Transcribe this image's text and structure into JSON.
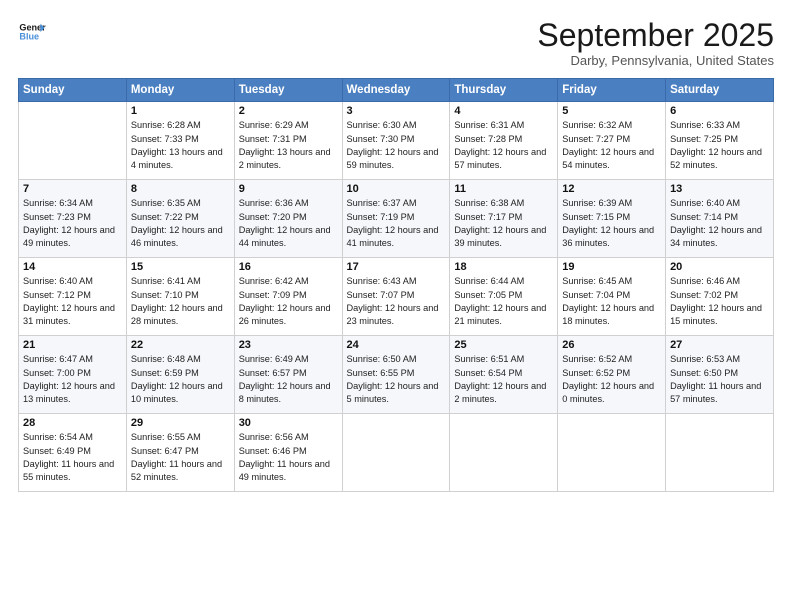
{
  "logo": {
    "line1": "General",
    "line2": "Blue"
  },
  "title": "September 2025",
  "location": "Darby, Pennsylvania, United States",
  "columns": [
    "Sunday",
    "Monday",
    "Tuesday",
    "Wednesday",
    "Thursday",
    "Friday",
    "Saturday"
  ],
  "weeks": [
    [
      {
        "day": "",
        "sunrise": "",
        "sunset": "",
        "daylight": ""
      },
      {
        "day": "1",
        "sunrise": "Sunrise: 6:28 AM",
        "sunset": "Sunset: 7:33 PM",
        "daylight": "Daylight: 13 hours and 4 minutes."
      },
      {
        "day": "2",
        "sunrise": "Sunrise: 6:29 AM",
        "sunset": "Sunset: 7:31 PM",
        "daylight": "Daylight: 13 hours and 2 minutes."
      },
      {
        "day": "3",
        "sunrise": "Sunrise: 6:30 AM",
        "sunset": "Sunset: 7:30 PM",
        "daylight": "Daylight: 12 hours and 59 minutes."
      },
      {
        "day": "4",
        "sunrise": "Sunrise: 6:31 AM",
        "sunset": "Sunset: 7:28 PM",
        "daylight": "Daylight: 12 hours and 57 minutes."
      },
      {
        "day": "5",
        "sunrise": "Sunrise: 6:32 AM",
        "sunset": "Sunset: 7:27 PM",
        "daylight": "Daylight: 12 hours and 54 minutes."
      },
      {
        "day": "6",
        "sunrise": "Sunrise: 6:33 AM",
        "sunset": "Sunset: 7:25 PM",
        "daylight": "Daylight: 12 hours and 52 minutes."
      }
    ],
    [
      {
        "day": "7",
        "sunrise": "Sunrise: 6:34 AM",
        "sunset": "Sunset: 7:23 PM",
        "daylight": "Daylight: 12 hours and 49 minutes."
      },
      {
        "day": "8",
        "sunrise": "Sunrise: 6:35 AM",
        "sunset": "Sunset: 7:22 PM",
        "daylight": "Daylight: 12 hours and 46 minutes."
      },
      {
        "day": "9",
        "sunrise": "Sunrise: 6:36 AM",
        "sunset": "Sunset: 7:20 PM",
        "daylight": "Daylight: 12 hours and 44 minutes."
      },
      {
        "day": "10",
        "sunrise": "Sunrise: 6:37 AM",
        "sunset": "Sunset: 7:19 PM",
        "daylight": "Daylight: 12 hours and 41 minutes."
      },
      {
        "day": "11",
        "sunrise": "Sunrise: 6:38 AM",
        "sunset": "Sunset: 7:17 PM",
        "daylight": "Daylight: 12 hours and 39 minutes."
      },
      {
        "day": "12",
        "sunrise": "Sunrise: 6:39 AM",
        "sunset": "Sunset: 7:15 PM",
        "daylight": "Daylight: 12 hours and 36 minutes."
      },
      {
        "day": "13",
        "sunrise": "Sunrise: 6:40 AM",
        "sunset": "Sunset: 7:14 PM",
        "daylight": "Daylight: 12 hours and 34 minutes."
      }
    ],
    [
      {
        "day": "14",
        "sunrise": "Sunrise: 6:40 AM",
        "sunset": "Sunset: 7:12 PM",
        "daylight": "Daylight: 12 hours and 31 minutes."
      },
      {
        "day": "15",
        "sunrise": "Sunrise: 6:41 AM",
        "sunset": "Sunset: 7:10 PM",
        "daylight": "Daylight: 12 hours and 28 minutes."
      },
      {
        "day": "16",
        "sunrise": "Sunrise: 6:42 AM",
        "sunset": "Sunset: 7:09 PM",
        "daylight": "Daylight: 12 hours and 26 minutes."
      },
      {
        "day": "17",
        "sunrise": "Sunrise: 6:43 AM",
        "sunset": "Sunset: 7:07 PM",
        "daylight": "Daylight: 12 hours and 23 minutes."
      },
      {
        "day": "18",
        "sunrise": "Sunrise: 6:44 AM",
        "sunset": "Sunset: 7:05 PM",
        "daylight": "Daylight: 12 hours and 21 minutes."
      },
      {
        "day": "19",
        "sunrise": "Sunrise: 6:45 AM",
        "sunset": "Sunset: 7:04 PM",
        "daylight": "Daylight: 12 hours and 18 minutes."
      },
      {
        "day": "20",
        "sunrise": "Sunrise: 6:46 AM",
        "sunset": "Sunset: 7:02 PM",
        "daylight": "Daylight: 12 hours and 15 minutes."
      }
    ],
    [
      {
        "day": "21",
        "sunrise": "Sunrise: 6:47 AM",
        "sunset": "Sunset: 7:00 PM",
        "daylight": "Daylight: 12 hours and 13 minutes."
      },
      {
        "day": "22",
        "sunrise": "Sunrise: 6:48 AM",
        "sunset": "Sunset: 6:59 PM",
        "daylight": "Daylight: 12 hours and 10 minutes."
      },
      {
        "day": "23",
        "sunrise": "Sunrise: 6:49 AM",
        "sunset": "Sunset: 6:57 PM",
        "daylight": "Daylight: 12 hours and 8 minutes."
      },
      {
        "day": "24",
        "sunrise": "Sunrise: 6:50 AM",
        "sunset": "Sunset: 6:55 PM",
        "daylight": "Daylight: 12 hours and 5 minutes."
      },
      {
        "day": "25",
        "sunrise": "Sunrise: 6:51 AM",
        "sunset": "Sunset: 6:54 PM",
        "daylight": "Daylight: 12 hours and 2 minutes."
      },
      {
        "day": "26",
        "sunrise": "Sunrise: 6:52 AM",
        "sunset": "Sunset: 6:52 PM",
        "daylight": "Daylight: 12 hours and 0 minutes."
      },
      {
        "day": "27",
        "sunrise": "Sunrise: 6:53 AM",
        "sunset": "Sunset: 6:50 PM",
        "daylight": "Daylight: 11 hours and 57 minutes."
      }
    ],
    [
      {
        "day": "28",
        "sunrise": "Sunrise: 6:54 AM",
        "sunset": "Sunset: 6:49 PM",
        "daylight": "Daylight: 11 hours and 55 minutes."
      },
      {
        "day": "29",
        "sunrise": "Sunrise: 6:55 AM",
        "sunset": "Sunset: 6:47 PM",
        "daylight": "Daylight: 11 hours and 52 minutes."
      },
      {
        "day": "30",
        "sunrise": "Sunrise: 6:56 AM",
        "sunset": "Sunset: 6:46 PM",
        "daylight": "Daylight: 11 hours and 49 minutes."
      },
      {
        "day": "",
        "sunrise": "",
        "sunset": "",
        "daylight": ""
      },
      {
        "day": "",
        "sunrise": "",
        "sunset": "",
        "daylight": ""
      },
      {
        "day": "",
        "sunrise": "",
        "sunset": "",
        "daylight": ""
      },
      {
        "day": "",
        "sunrise": "",
        "sunset": "",
        "daylight": ""
      }
    ]
  ]
}
